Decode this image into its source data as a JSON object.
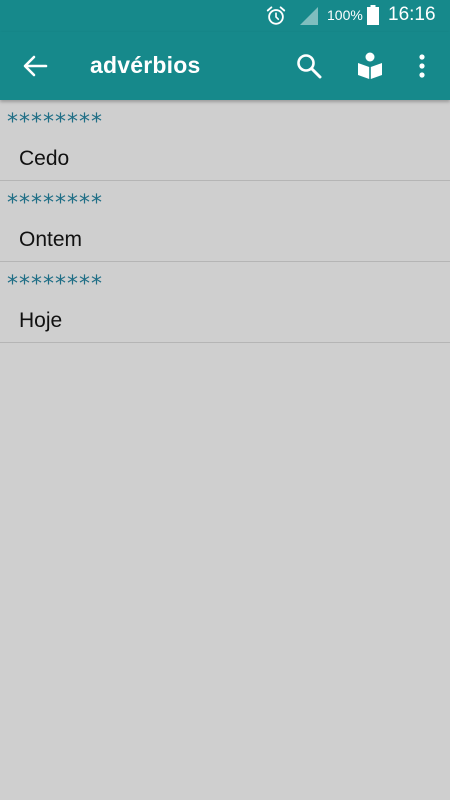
{
  "status_bar": {
    "battery_percent": "100%",
    "time": "16:16",
    "icons": [
      "alarm-icon",
      "signal-icon",
      "battery-icon"
    ]
  },
  "app_bar": {
    "title": "advérbios",
    "icons": [
      "back-arrow-icon",
      "search-icon",
      "reader-icon",
      "more-vert-icon"
    ]
  },
  "items": [
    {
      "stars": "********",
      "word": "Cedo"
    },
    {
      "stars": "********",
      "word": "Ontem"
    },
    {
      "stars": "********",
      "word": "Hoje"
    }
  ],
  "colors": {
    "app_bar": "#16898b",
    "background": "#cfcfcf",
    "stars": "#1f6e86",
    "divider": "#b5b5b5"
  }
}
